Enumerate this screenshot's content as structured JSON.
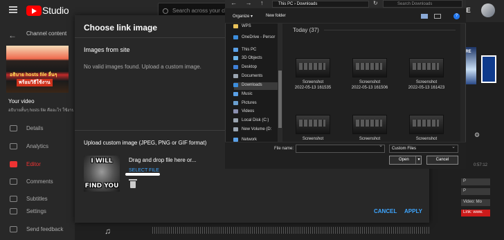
{
  "studio": {
    "logo_text": "Studio",
    "search_placeholder": "Search across your chan",
    "create_label": "TE",
    "back_label": "Channel content",
    "thumb_line1": "อธิบาย hosts file ลื่นๆ",
    "thumb_line2": "พร้อมวิธีใช้งาน",
    "your_video_label": "Your video",
    "video_title": "อธิบายสั้นๆ hosts file คืออะไร ใช้งานยังไง",
    "nav": [
      {
        "label": "Details"
      },
      {
        "label": "Analytics"
      },
      {
        "label": "Editor"
      },
      {
        "label": "Comments"
      },
      {
        "label": "Subtitles"
      },
      {
        "label": "Settings"
      },
      {
        "label": "Send feedback"
      }
    ],
    "right_thumb_label": "ARE",
    "timestamp": "0:57:12",
    "tags": [
      "P",
      "P",
      "Video: Mo",
      "Link: www."
    ]
  },
  "dialog": {
    "title": "Choose link image",
    "images_title": "Images from site",
    "no_images_text": "No valid images found. Upload a custom image.",
    "upload_title": "Upload custom image (JPEG, PNG or GIF format)",
    "meme_top": "I WILL",
    "meme_bottom": "FIND YOU",
    "drag_text": "Drag and drop file here or...",
    "select_file": "SELECT FILE",
    "cancel": "CANCEL",
    "apply": "APPLY"
  },
  "file_dialog": {
    "nav_glyphs": "← → ↑ ↓",
    "path": "This PC  ›  Downloads",
    "search_placeholder": "Search Downloads",
    "organize": "Organize ▾",
    "new_folder": "New folder",
    "tree": [
      {
        "label": "WPS",
        "icon": "folder-icon",
        "color": "#e8c25a"
      },
      {
        "label": "OneDrive - Persor",
        "icon": "cloud-icon",
        "color": "#3c8ddc"
      },
      {
        "label": "This PC",
        "icon": "pc-icon",
        "color": "#5aa0e6"
      },
      {
        "label": "3D Objects",
        "icon": "cube-icon",
        "color": "#6fb5e8"
      },
      {
        "label": "Desktop",
        "icon": "desktop-icon",
        "color": "#3f7fd6"
      },
      {
        "label": "Documents",
        "icon": "documents-icon",
        "color": "#9aa4b0"
      },
      {
        "label": "Downloads",
        "icon": "download-icon",
        "color": "#3c8ddc"
      },
      {
        "label": "Music",
        "icon": "music-icon",
        "color": "#5aa0e6"
      },
      {
        "label": "Pictures",
        "icon": "pictures-icon",
        "color": "#6a9fd0"
      },
      {
        "label": "Videos",
        "icon": "videos-icon",
        "color": "#8a8fb0"
      },
      {
        "label": "Local Disk (C:)",
        "icon": "disk-icon",
        "color": "#9aa4b0"
      },
      {
        "label": "New Volume (D:",
        "icon": "disk-icon",
        "color": "#9aa4b0"
      },
      {
        "label": "Network",
        "icon": "network-icon",
        "color": "#5aa0e6"
      }
    ],
    "group_label": "Today (37)",
    "files": [
      {
        "name": "Screenshot",
        "date": "2022-05-13 161535"
      },
      {
        "name": "Screenshot",
        "date": "2022-05-13 161506"
      },
      {
        "name": "Screenshot",
        "date": "2022-05-13 161423"
      },
      {
        "name": "Screenshot",
        "date": ""
      },
      {
        "name": "Screenshot",
        "date": ""
      },
      {
        "name": "Screenshot",
        "date": ""
      }
    ],
    "filename_label": "File name:",
    "filename_value": "",
    "filter": "Custom Files",
    "open": "Open",
    "cancel": "Cancel"
  }
}
